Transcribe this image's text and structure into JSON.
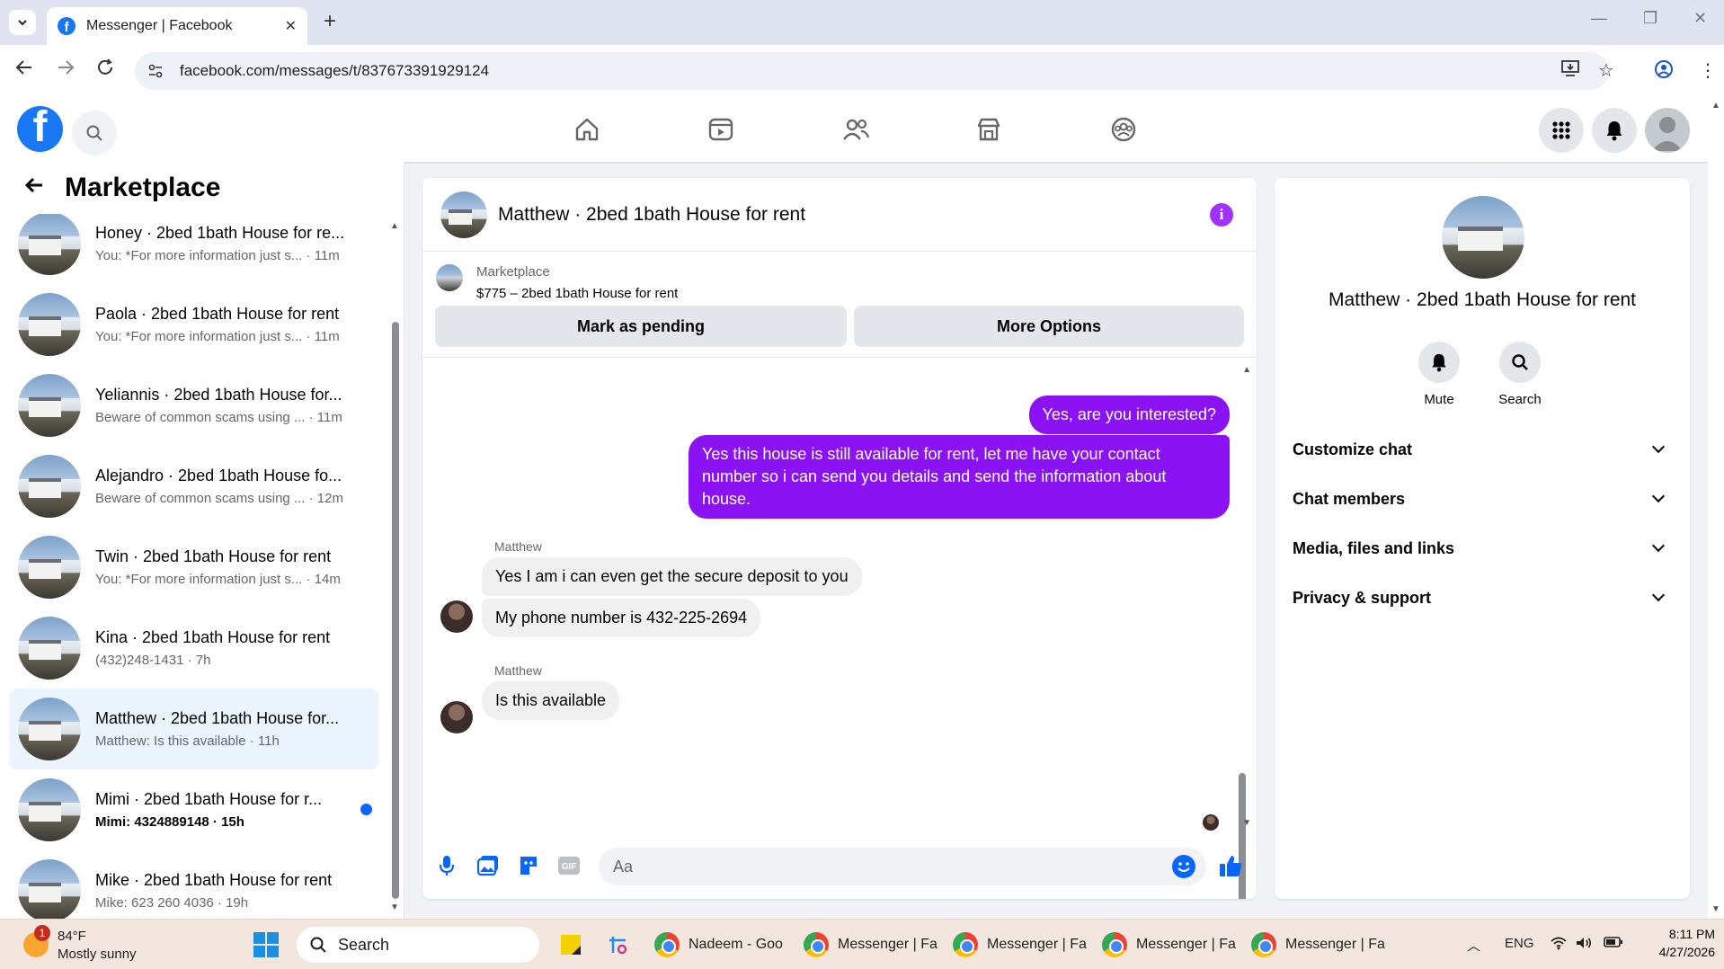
{
  "browser": {
    "tab_title": "Messenger | Facebook",
    "url": "facebook.com/messages/t/837673391929124"
  },
  "left_panel": {
    "title": "Marketplace",
    "conversations": [
      {
        "name": "Honey · 2bed 1bath House for re...",
        "preview": "You: *For more information just s... · 11m",
        "active": false,
        "unread": false
      },
      {
        "name": "Paola · 2bed 1bath House for rent",
        "preview": "You: *For more information just s... · 11m",
        "active": false,
        "unread": false
      },
      {
        "name": "Yeliannis · 2bed 1bath House for...",
        "preview": "Beware of common scams using ... · 11m",
        "active": false,
        "unread": false
      },
      {
        "name": "Alejandro · 2bed 1bath House fo...",
        "preview": "Beware of common scams using ... · 12m",
        "active": false,
        "unread": false
      },
      {
        "name": "Twin · 2bed 1bath House for rent",
        "preview": "You: *For more information just s... · 14m",
        "active": false,
        "unread": false
      },
      {
        "name": "Kina · 2bed 1bath House for rent",
        "preview": "(432)248-1431 · 7h",
        "active": false,
        "unread": false
      },
      {
        "name": "Matthew · 2bed 1bath House for...",
        "preview": "Matthew: Is this available · 11h",
        "active": true,
        "unread": false
      },
      {
        "name": "Mimi · 2bed 1bath House for r...",
        "preview": "Mimi: 4324889148 · 15h",
        "active": false,
        "unread": true
      },
      {
        "name": "Mike · 2bed 1bath House for rent",
        "preview": "Mike: 623 260 4036 · 19h",
        "active": false,
        "unread": false
      }
    ]
  },
  "chat": {
    "title": "Matthew · 2bed 1bath House for rent",
    "marketplace_label": "Marketplace",
    "listing": "$775 – 2bed 1bath House for rent",
    "mark_pending": "Mark as pending",
    "more_options": "More Options",
    "messages": {
      "out1": "Yes, are you interested?",
      "out2": "Yes this house is still available for rent, let me have your contact number so i can send you details and send the information about house.",
      "sender1": "Matthew",
      "in1": "Yes I am i can even get the secure deposit to you",
      "in2": "My phone number is 432-225-2694",
      "sender2": "Matthew",
      "in3": "Is this available"
    },
    "composer_placeholder": "Aa"
  },
  "right_panel": {
    "name": "Matthew · 2bed 1bath House for rent",
    "mute": "Mute",
    "search": "Search",
    "sections": [
      "Customize chat",
      "Chat members",
      "Media, files and links",
      "Privacy & support"
    ]
  },
  "taskbar": {
    "weather_badge": "1",
    "temp": "84°F",
    "weather": "Mostly sunny",
    "search": "Search",
    "apps": [
      "Nadeem - Goo",
      "Messenger | Fa",
      "Messenger | Fa",
      "Messenger | Fa",
      "Messenger | Fa"
    ],
    "lang": "ENG",
    "time": "8:11 PM",
    "date": "4/27/2026"
  },
  "colors": {
    "accent": "#8a12f3",
    "facebook_blue": "#1877f2",
    "active_row": "#ebf5ff"
  }
}
